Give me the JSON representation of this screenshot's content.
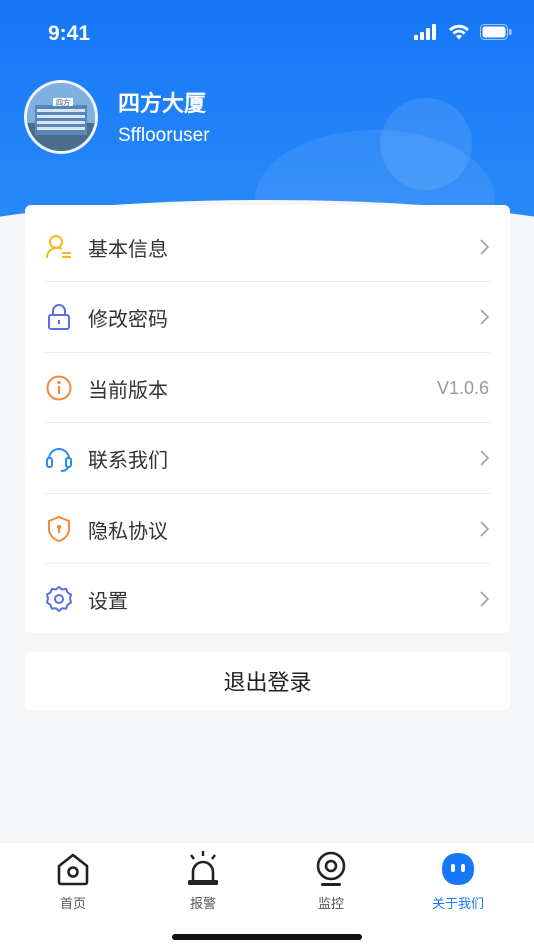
{
  "status_bar": {
    "time": "9:41"
  },
  "profile": {
    "name": "四方大厦",
    "username": "Sfflooruser",
    "avatar_text": "四方"
  },
  "menu": {
    "items": [
      {
        "label": "基本信息",
        "icon": "user-info-icon",
        "color": "#f5b920",
        "value": ""
      },
      {
        "label": "修改密码",
        "icon": "lock-icon",
        "color": "#5b6fe0",
        "value": ""
      },
      {
        "label": "当前版本",
        "icon": "info-icon",
        "color": "#f08a3c",
        "value": "V1.0.6"
      },
      {
        "label": "联系我们",
        "icon": "headset-icon",
        "color": "#2d8cf0",
        "value": ""
      },
      {
        "label": "隐私协议",
        "icon": "shield-icon",
        "color": "#f08a3c",
        "value": ""
      },
      {
        "label": "设置",
        "icon": "gear-icon",
        "color": "#5b6fe0",
        "value": ""
      }
    ]
  },
  "logout": {
    "label": "退出登录"
  },
  "tabbar": {
    "tabs": [
      {
        "label": "首页",
        "icon": "home-icon"
      },
      {
        "label": "报警",
        "icon": "alarm-siren-icon"
      },
      {
        "label": "监控",
        "icon": "camera-icon"
      },
      {
        "label": "关于我们",
        "icon": "about-us-icon",
        "active": true
      }
    ]
  },
  "colors": {
    "primary": "#1677f7",
    "background": "#f5f6f8"
  }
}
